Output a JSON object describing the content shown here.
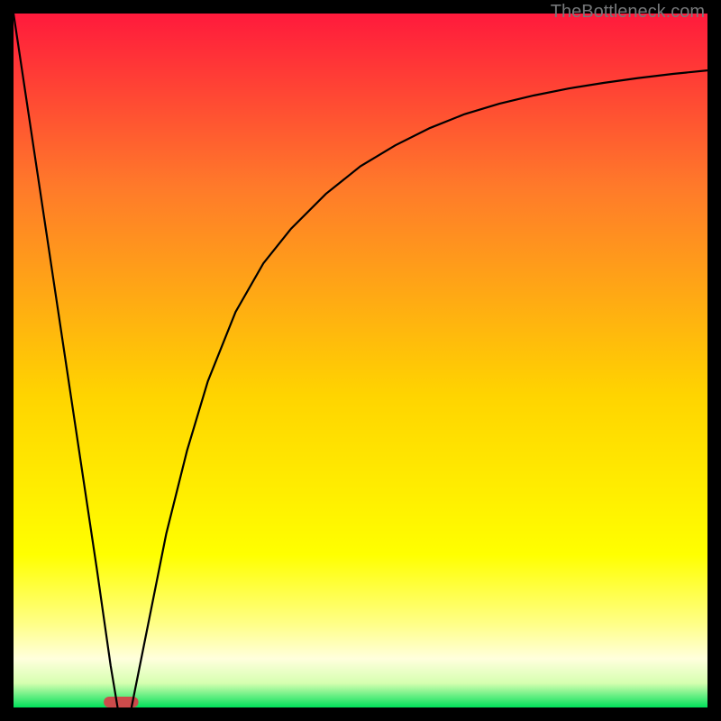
{
  "attribution": "TheBottleneck.com",
  "colors": {
    "black": "#000000",
    "gradient_top": "#ff1a3c",
    "gradient_mid1": "#ff7a2a",
    "gradient_mid2": "#ffd400",
    "gradient_mid3": "#ffff66",
    "gradient_mid4": "#ffffcc",
    "gradient_bottom": "#00e05a",
    "curve": "#000000",
    "marker": "#cc4b4b"
  },
  "chart_data": {
    "type": "line",
    "title": "",
    "xlabel": "",
    "ylabel": "",
    "xlim": [
      0,
      100
    ],
    "ylim": [
      0,
      100
    ],
    "marker": {
      "x_range": [
        13,
        18
      ],
      "y": 0,
      "color": "#cc4b4b"
    },
    "annotations": [],
    "series": [
      {
        "name": "left-branch",
        "x": [
          0,
          3,
          6,
          9,
          12,
          14,
          15
        ],
        "values": [
          100,
          80,
          60,
          40,
          20,
          6,
          0
        ]
      },
      {
        "name": "right-branch",
        "x": [
          17,
          18,
          20,
          22,
          25,
          28,
          32,
          36,
          40,
          45,
          50,
          55,
          60,
          65,
          70,
          75,
          80,
          85,
          90,
          95,
          100
        ],
        "values": [
          0,
          5,
          15,
          25,
          37,
          47,
          57,
          64,
          69,
          74,
          78,
          81,
          83.5,
          85.5,
          87,
          88.2,
          89.2,
          90,
          90.7,
          91.3,
          91.8
        ]
      }
    ],
    "gradient_stops": [
      {
        "offset": 0.0,
        "color": "#ff1a3c"
      },
      {
        "offset": 0.25,
        "color": "#ff7a2a"
      },
      {
        "offset": 0.55,
        "color": "#ffd400"
      },
      {
        "offset": 0.78,
        "color": "#ffff00"
      },
      {
        "offset": 0.88,
        "color": "#ffff88"
      },
      {
        "offset": 0.93,
        "color": "#ffffdd"
      },
      {
        "offset": 0.965,
        "color": "#d6ffb0"
      },
      {
        "offset": 1.0,
        "color": "#00e05a"
      }
    ]
  }
}
